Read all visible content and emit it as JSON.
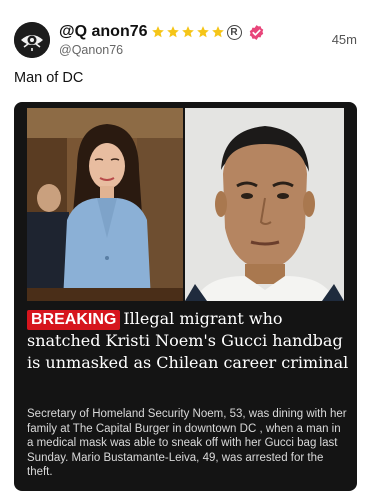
{
  "author": {
    "display_name": "@Q anon76",
    "handle": "@Qanon76",
    "star_count": 5,
    "registered_mark": "R",
    "verified_color": "#e8457a",
    "avatar_icon": "stylized-eye-logo"
  },
  "timestamp": "45m",
  "post_text": "Man of DC",
  "card": {
    "badge": "BREAKING",
    "headline": "Illegal migrant who snatched Kristi Noem's Gucci handbag is unmasked as Chilean career criminal",
    "summary": "Secretary of Homeland Security Noem, 53, was dining with her family at The Capital Burger in downtown DC , when a man in a medical mask was able to sneak off with her Gucci bag last Sunday. Mario Bustamante-Leiva, 49, was arrested for the theft.",
    "badge_color": "#d6151d",
    "background_color": "#141414"
  }
}
